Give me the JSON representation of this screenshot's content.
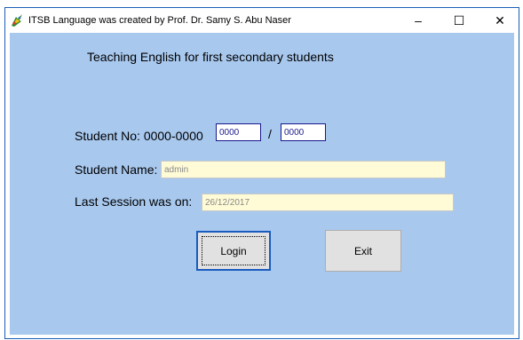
{
  "window": {
    "title": "ITSB Language was created by Prof. Dr. Samy S. Abu Naser",
    "minimize_glyph": "–",
    "maximize_glyph": "☐",
    "close_glyph": "✕"
  },
  "form": {
    "heading": "Teaching English for first secondary students",
    "student_no_label": "Student No: 0000-0000",
    "student_no_part1": "0000",
    "separator": "/",
    "student_no_part2": "0000",
    "student_name_label": "Student Name:",
    "student_name_value": "admin",
    "last_session_label": "Last Session was on:",
    "last_session_value": "26/12/2017",
    "login_label": "Login",
    "exit_label": "Exit"
  },
  "colors": {
    "client_background": "#a8c8ee",
    "readonly_field": "#fffbd6",
    "accent_border": "#1a5bbf"
  },
  "icons": {
    "app_icon": "colorful-app-icon"
  }
}
